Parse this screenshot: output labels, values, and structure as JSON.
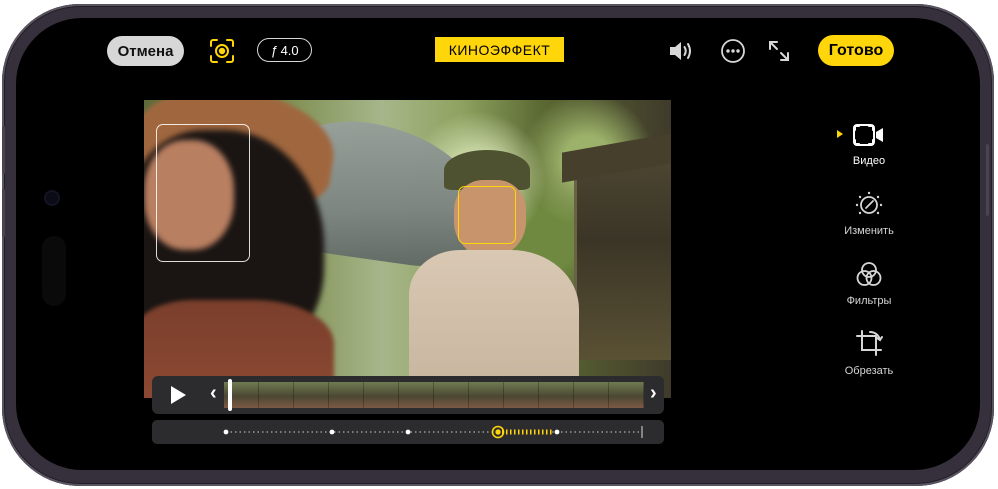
{
  "topbar": {
    "cancel_label": "Отмена",
    "aperture_label": "4.0",
    "aperture_prefix": "ƒ",
    "mode_label": "КИНОЭФФЕКТ",
    "done_label": "Готово"
  },
  "tools": [
    {
      "label": "Видео",
      "icon": "video-camera-icon",
      "active": true
    },
    {
      "label": "Изменить",
      "icon": "adjust-dial-icon",
      "active": false
    },
    {
      "label": "Фильтры",
      "icon": "filters-icon",
      "active": false
    },
    {
      "label": "Обрезать",
      "icon": "crop-rotate-icon",
      "active": false
    }
  ],
  "colors": {
    "accent": "#ffd60a",
    "background": "#000000",
    "frame": "#35303b"
  },
  "timeline": {
    "playhead_fraction": 0.02,
    "focus_keyframe_fraction": 0.71
  }
}
